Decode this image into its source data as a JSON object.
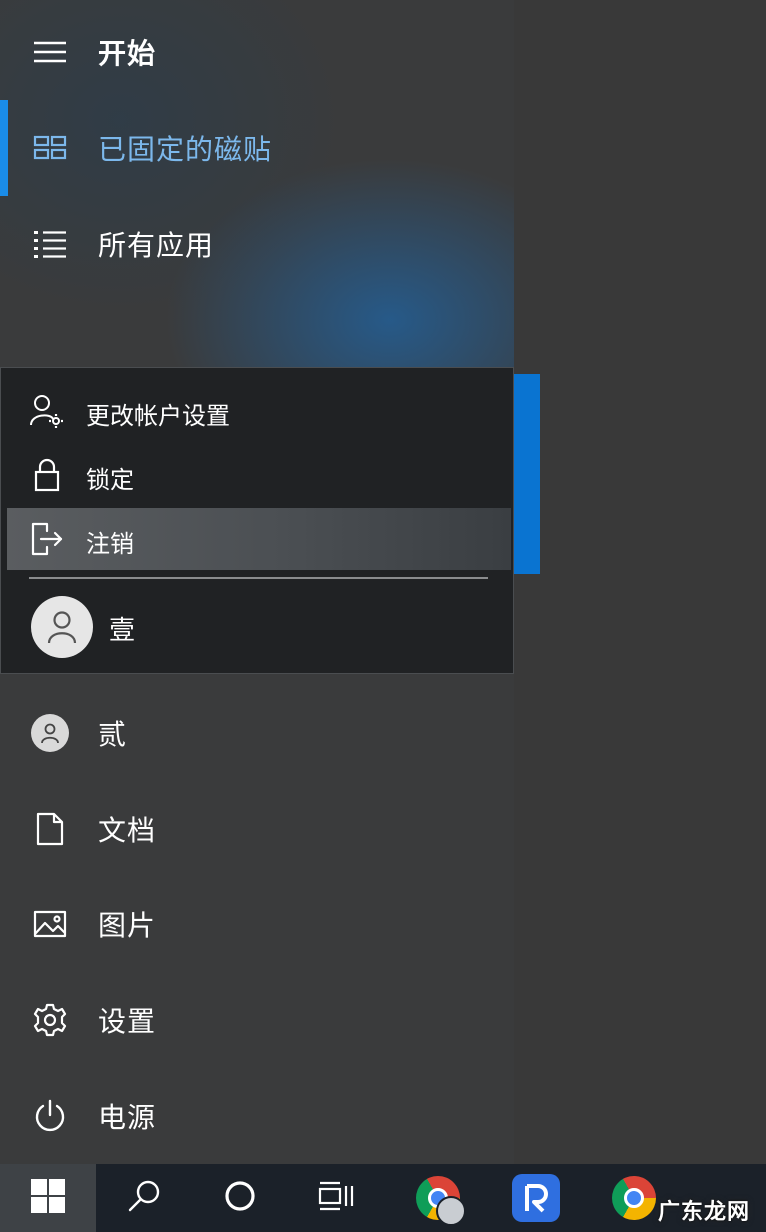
{
  "start_menu": {
    "header": {
      "title": "开始",
      "icon": "hamburger-icon"
    },
    "nav": [
      {
        "label": "已固定的磁贴",
        "icon": "tiles-icon",
        "active": true
      },
      {
        "label": "所有应用",
        "icon": "list-icon",
        "active": false
      }
    ],
    "items": [
      {
        "label": "贰",
        "icon": "avatar-icon"
      },
      {
        "label": "文档",
        "icon": "document-icon"
      },
      {
        "label": "图片",
        "icon": "picture-icon"
      },
      {
        "label": "设置",
        "icon": "gear-icon"
      },
      {
        "label": "电源",
        "icon": "power-icon"
      }
    ]
  },
  "account_menu": {
    "items": [
      {
        "label": "更改帐户设置",
        "icon": "user-settings-icon"
      },
      {
        "label": "锁定",
        "icon": "lock-icon"
      },
      {
        "label": "注销",
        "icon": "sign-out-icon",
        "hovered": true
      }
    ],
    "current_user": {
      "label": "壹",
      "icon": "avatar-icon"
    }
  },
  "taskbar": {
    "items": [
      "windows-start-icon",
      "search-icon",
      "cortana-icon",
      "task-view-icon",
      "chrome-icon",
      "app-r-icon",
      "chrome-icon"
    ]
  },
  "watermark": "广东龙网",
  "colors": {
    "accent": "#1a8ce8",
    "active_label": "#7cb8ec",
    "taskbar": "#1b2129"
  }
}
